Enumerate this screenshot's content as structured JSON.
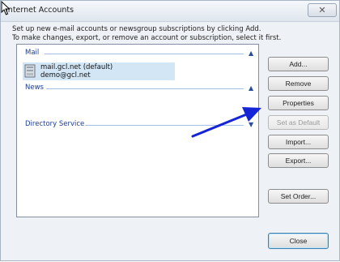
{
  "window": {
    "title": "Internet Accounts",
    "close_glyph": "✕",
    "close_icon": "close-icon"
  },
  "description": {
    "line1": "Set up new e-mail accounts or newsgroup subscriptions by clicking Add.",
    "line2": "To make changes, export, or remove an account or subscription, select it first."
  },
  "groups": {
    "mail": {
      "label": "Mail",
      "chevron": "▲",
      "accounts": [
        {
          "line1": "mail.gcl.net (default)",
          "line2": "demo@gcl.net",
          "icon": "mail-account-icon"
        }
      ]
    },
    "news": {
      "label": "News",
      "chevron": "▲"
    },
    "directory": {
      "label": "Directory Service",
      "chevron": "▼"
    }
  },
  "buttons": {
    "add": "Add...",
    "remove": "Remove",
    "properties": "Properties",
    "set_default": "Set as Default",
    "import": "Import...",
    "export": "Export...",
    "set_order": "Set Order...",
    "close": "Close"
  },
  "annotation": {
    "arrow_color": "#1424d6"
  },
  "colors": {
    "accent": "#1e3d8f",
    "selection": "#d2e6f6"
  }
}
